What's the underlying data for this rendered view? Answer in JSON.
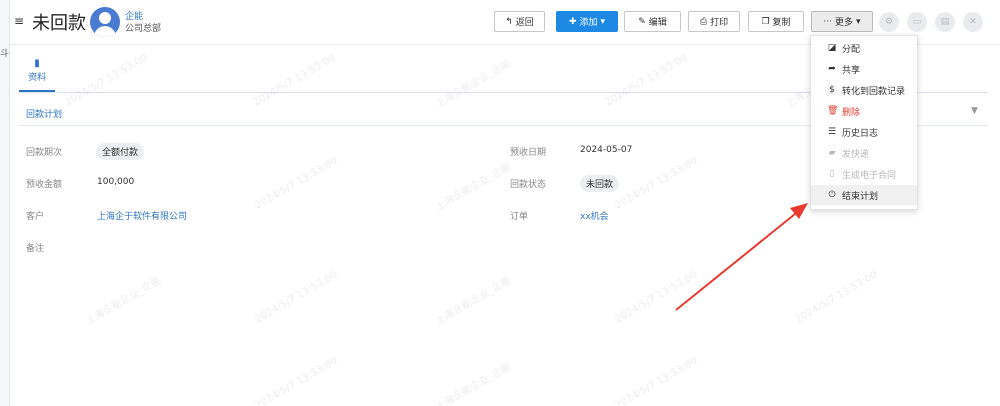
{
  "left_edge_mark": "斗",
  "header": {
    "menu_icon": "list-icon",
    "title": "未回款",
    "user_name": "企能",
    "user_dept": "公司总部"
  },
  "toolbar": {
    "back_label": "返回",
    "add_label": "添加",
    "edit_label": "编辑",
    "print_label": "打印",
    "copy_label": "复制",
    "more_label": "更多"
  },
  "tabs": [
    {
      "label": "资料",
      "icon": "book-icon"
    }
  ],
  "section": {
    "title": "回款计划"
  },
  "fields": {
    "period_label": "回款期次",
    "period_value": "全额付款",
    "due_date_label": "预收日期",
    "due_date_value": "2024-05-07",
    "amount_label": "预收金额",
    "amount_value": "100,000",
    "status_label": "回款状态",
    "status_value": "未回款",
    "customer_label": "客户",
    "customer_value": "上海企于软件有限公司",
    "order_label": "订单",
    "order_value": "xx机会",
    "remark_label": "备注"
  },
  "more_menu": [
    {
      "label": "分配",
      "icon": "assign-icon",
      "state": "normal"
    },
    {
      "label": "共享",
      "icon": "share-icon",
      "state": "normal"
    },
    {
      "label": "转化到回款记录",
      "icon": "dollar-icon",
      "state": "normal"
    },
    {
      "label": "删除",
      "icon": "trash-icon",
      "state": "danger"
    },
    {
      "label": "历史日志",
      "icon": "list-icon",
      "state": "normal"
    },
    {
      "label": "发快递",
      "icon": "truck-icon",
      "state": "disabled"
    },
    {
      "label": "生成电子合同",
      "icon": "document-icon",
      "state": "disabled"
    },
    {
      "label": "结束计划",
      "icon": "power-icon",
      "state": "hover"
    }
  ],
  "watermark": {
    "company": "上海企能企业_企能",
    "timestamp": "2024/5/7 13:53:00"
  }
}
